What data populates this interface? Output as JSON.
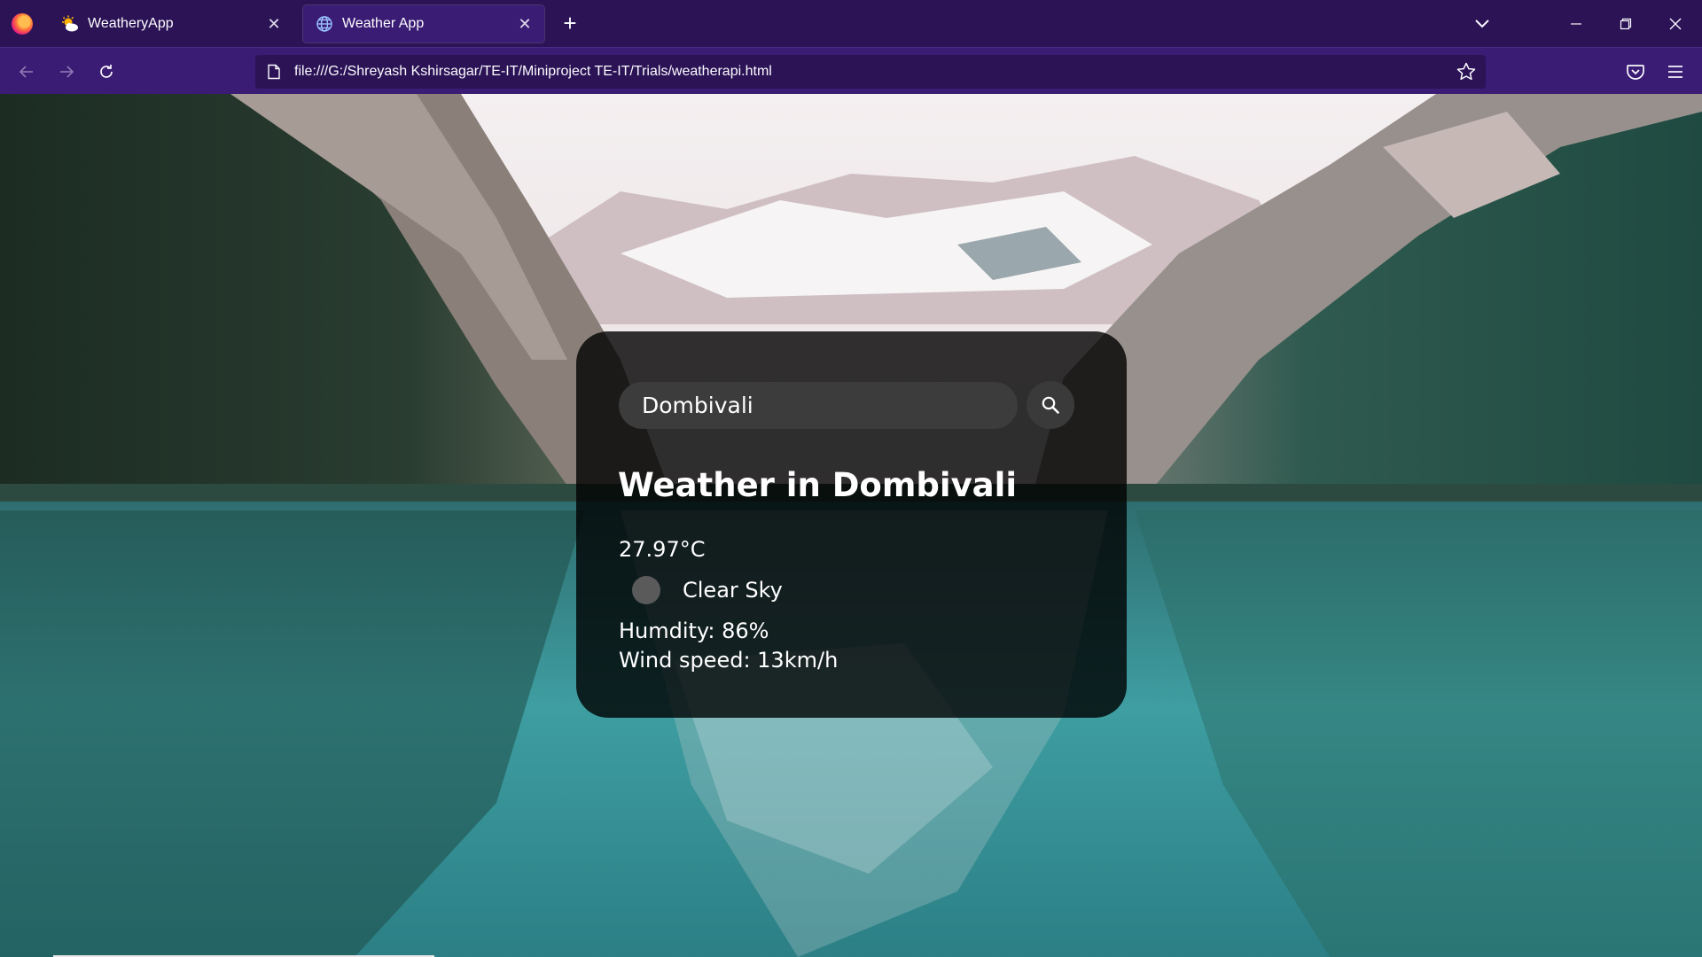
{
  "browser": {
    "tabs": [
      {
        "title": "WeatheryApp",
        "icon": "sun-cloud-icon",
        "active": false
      },
      {
        "title": "Weather App",
        "icon": "globe-icon",
        "active": true
      }
    ],
    "url": "file:///G:/Shreyash Kshirsagar/TE-IT/Miniproject TE-IT/Trials/weatherapi.html",
    "icons": [
      "firefox-logo",
      "close-icon",
      "plus-icon",
      "chevron-down-icon",
      "minimize-icon",
      "restore-icon",
      "back-icon",
      "forward-icon",
      "reload-icon",
      "page-icon",
      "star-icon",
      "pocket-icon",
      "hamburger-menu-icon"
    ],
    "colors": {
      "tab_strip": "#2b1356",
      "toolbar": "#3b1c74"
    }
  },
  "weather": {
    "search_value": "Dombivali",
    "heading": "Weather in Dombivali",
    "temperature": "27.97°C",
    "description": "Clear Sky",
    "humidity": "Humdity: 86%",
    "wind": "Wind speed: 13km/h",
    "icons": [
      "search-icon",
      "weather-condition-icon"
    ],
    "colors": {
      "card_bg": "rgba(0,0,0,0.8)",
      "input_bg": "#3c3c3c",
      "text": "#ffffff"
    }
  }
}
